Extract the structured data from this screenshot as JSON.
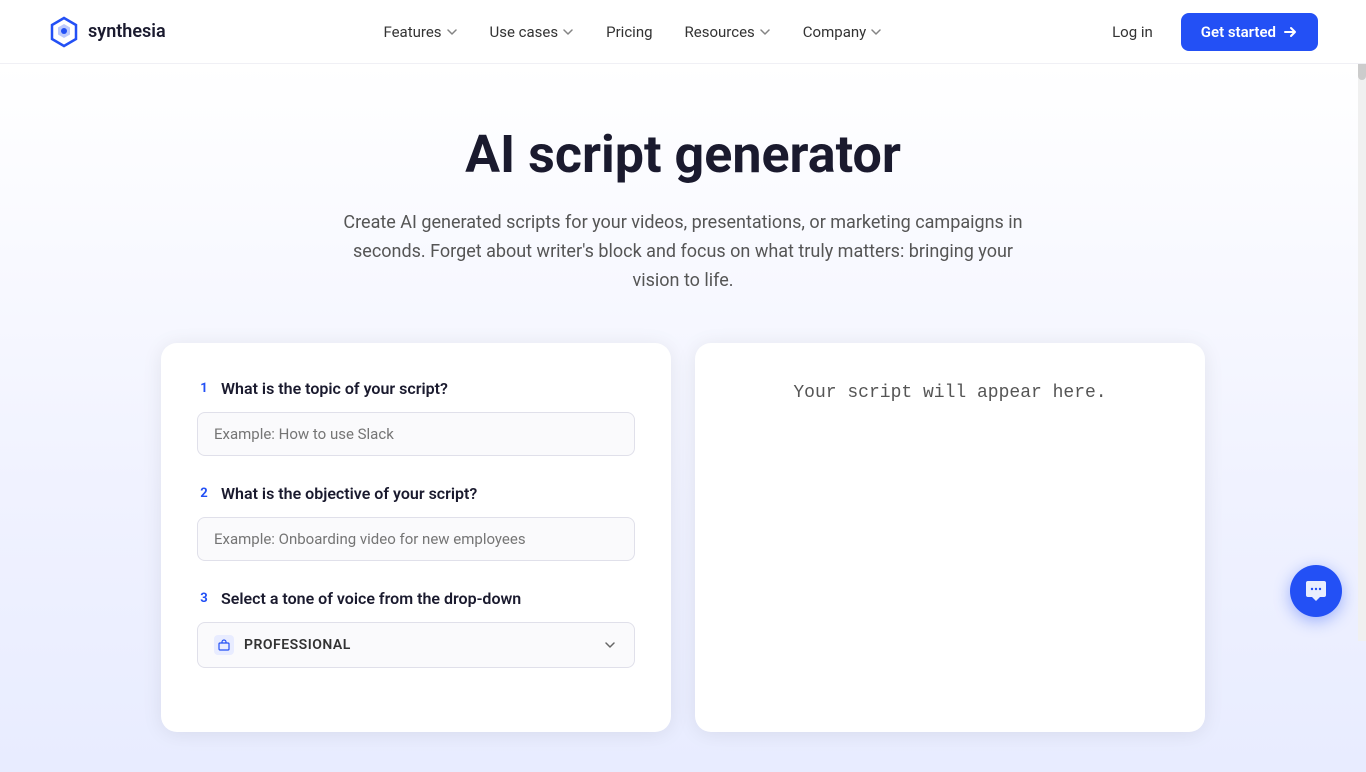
{
  "brand": {
    "name": "synthesia",
    "logo_alt": "Synthesia logo"
  },
  "nav": {
    "links": [
      {
        "label": "Features",
        "hasDropdown": true
      },
      {
        "label": "Use cases",
        "hasDropdown": true
      },
      {
        "label": "Pricing",
        "hasDropdown": false
      },
      {
        "label": "Resources",
        "hasDropdown": true
      },
      {
        "label": "Company",
        "hasDropdown": true
      }
    ],
    "login_label": "Log in",
    "cta_label": "Get started"
  },
  "hero": {
    "title": "AI script generator",
    "description": "Create AI generated scripts for your videos, presentations, or marketing campaigns in seconds. Forget about writer's block and focus on what truly matters: bringing your vision to life."
  },
  "form": {
    "steps": [
      {
        "number": "1",
        "title": "What is the topic of your script?",
        "placeholder": "Example: How to use Slack"
      },
      {
        "number": "2",
        "title": "What is the objective of your script?",
        "placeholder": "Example: Onboarding video for new employees"
      },
      {
        "number": "3",
        "title": "Select a tone of voice from the drop-down",
        "dropdown": true,
        "dropdown_value": "PROFESSIONAL"
      }
    ]
  },
  "script_output": {
    "placeholder": "Your script will appear here."
  },
  "colors": {
    "accent": "#2350f5",
    "text_dark": "#1a1a2e",
    "text_medium": "#555555"
  }
}
